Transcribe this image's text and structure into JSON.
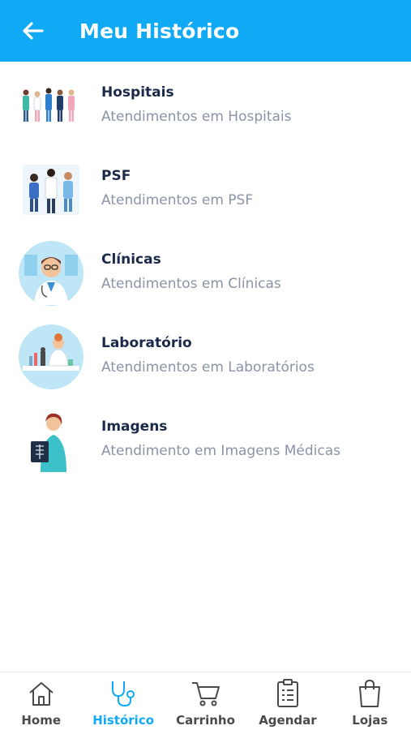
{
  "header": {
    "title": "Meu Histórico",
    "back_icon": "arrow-left-icon",
    "color": "#0fa9f5"
  },
  "items": [
    {
      "title": "Hospitais",
      "subtitle": "Atendimentos em Hospitais",
      "icon": "hospital-staff-illustration"
    },
    {
      "title": "PSF",
      "subtitle": "Atendimentos em PSF",
      "icon": "health-team-illustration"
    },
    {
      "title": "Clínicas",
      "subtitle": "Atendimentos em Clínicas",
      "icon": "doctor-illustration"
    },
    {
      "title": "Laboratório",
      "subtitle": "Atendimentos em Laboratórios",
      "icon": "lab-scientist-illustration"
    },
    {
      "title": "Imagens",
      "subtitle": "Atendimento em Imagens Médicas",
      "icon": "xray-nurse-illustration"
    }
  ],
  "nav": {
    "active": "Histórico",
    "active_color": "#0fa9f5",
    "items": [
      {
        "label": "Home",
        "icon": "home-icon"
      },
      {
        "label": "Histórico",
        "icon": "stethoscope-icon"
      },
      {
        "label": "Carrinho",
        "icon": "cart-icon"
      },
      {
        "label": "Agendar",
        "icon": "clipboard-icon"
      },
      {
        "label": "Lojas",
        "icon": "shopping-bag-icon"
      }
    ]
  }
}
